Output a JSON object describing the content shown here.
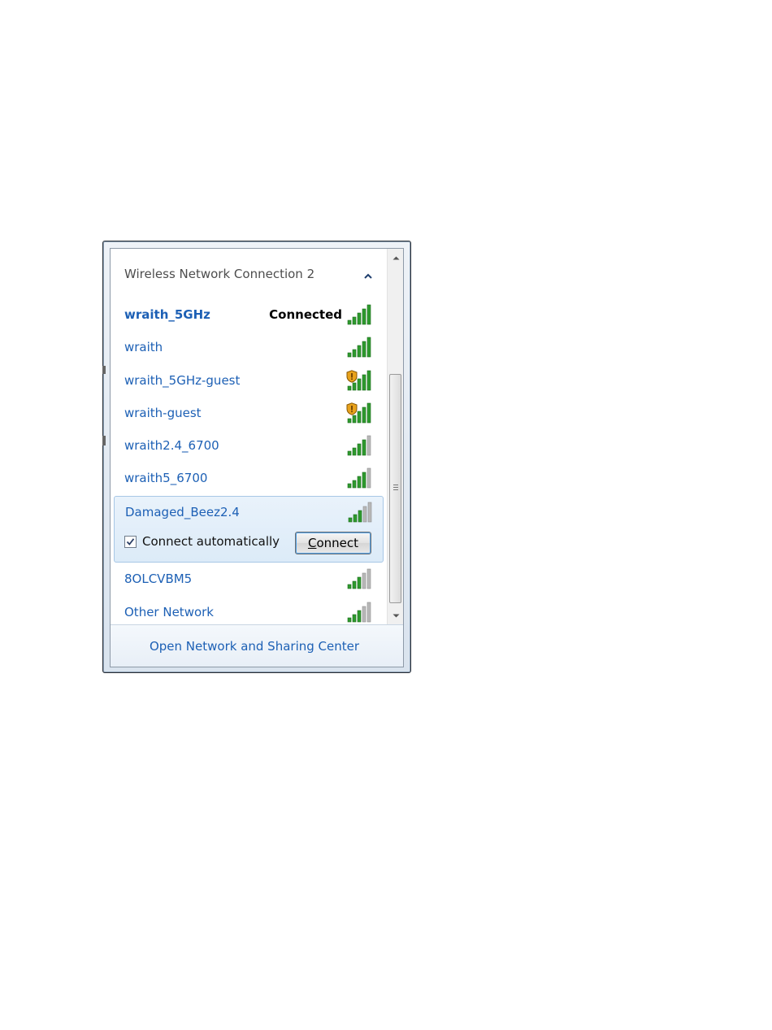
{
  "flyout": {
    "header": "Wireless Network Connection 2",
    "networks": [
      {
        "name": "wraith_5GHz",
        "status": "Connected",
        "signal_bars": 5,
        "secured_warning": false
      },
      {
        "name": "wraith",
        "signal_bars": 5,
        "secured_warning": false
      },
      {
        "name": "wraith_5GHz-guest",
        "signal_bars": 5,
        "secured_warning": true
      },
      {
        "name": "wraith-guest",
        "signal_bars": 5,
        "secured_warning": true
      },
      {
        "name": "wraith2.4_6700",
        "signal_bars": 4,
        "secured_warning": false
      },
      {
        "name": "wraith5_6700",
        "signal_bars": 4,
        "secured_warning": false
      },
      {
        "name": "Damaged_Beez2.4",
        "signal_bars": 3,
        "secured_warning": false,
        "selected": true
      },
      {
        "name": "8OLCVBM5",
        "signal_bars": 3,
        "secured_warning": false
      },
      {
        "name": "Other Network",
        "signal_bars": 3,
        "secured_warning": false
      }
    ],
    "selected_network": {
      "connect_automatically_label": "Connect automatically",
      "connect_automatically_checked": true,
      "connect_button_label_prefix": "C",
      "connect_button_label_rest": "onnect"
    },
    "footer_link": "Open Network and Sharing Center"
  },
  "colors": {
    "link_blue": "#1d60b5",
    "signal_green": "#2e9a2e",
    "signal_gray": "#b8b8b8",
    "selection_bg": "#dcebf8"
  }
}
